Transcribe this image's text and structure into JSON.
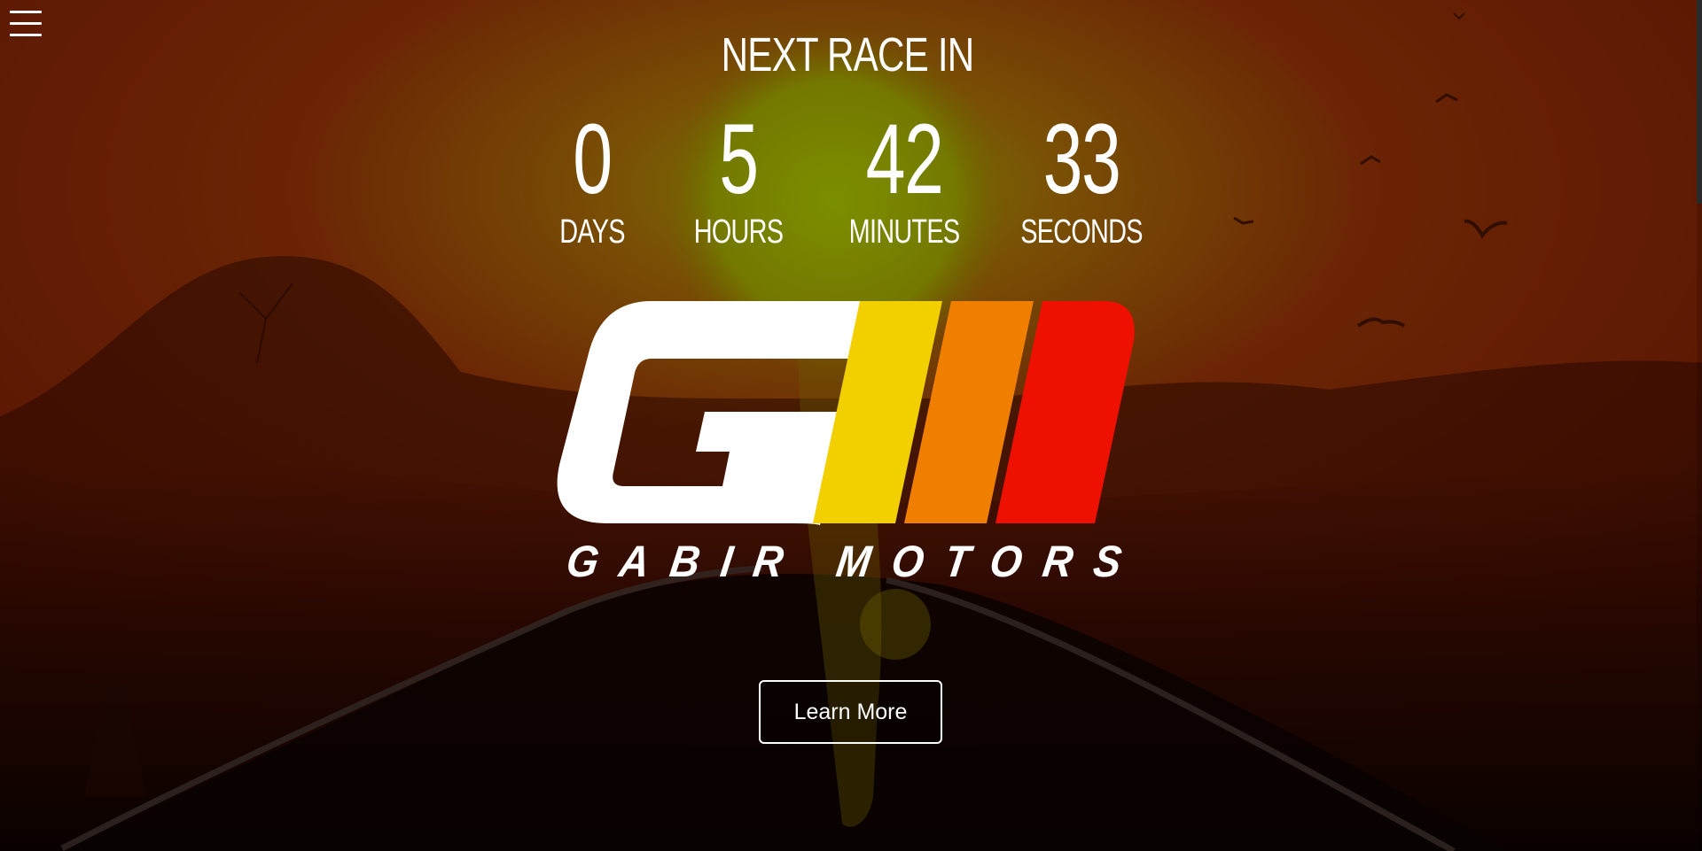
{
  "menu": {
    "icon": "hamburger-menu-icon"
  },
  "countdown": {
    "title": "NEXT RACE IN",
    "units": [
      {
        "value": "0",
        "label": "DAYS"
      },
      {
        "value": "5",
        "label": "HOURS"
      },
      {
        "value": "42",
        "label": "MINUTES"
      },
      {
        "value": "33",
        "label": "SECONDS"
      }
    ]
  },
  "logo": {
    "icon": "gabir-motors-logo",
    "brand_name": "GABIR MOTORS",
    "colors": {
      "letter": "#ffffff",
      "stripe_yellow": "#f2d000",
      "stripe_orange": "#f07f00",
      "stripe_red": "#ee1000"
    }
  },
  "cta": {
    "learn_more_label": "Learn More"
  },
  "theme": {
    "sky_top": "#7a1a04",
    "sun": "#8a9a00",
    "road": "#0a0402"
  }
}
